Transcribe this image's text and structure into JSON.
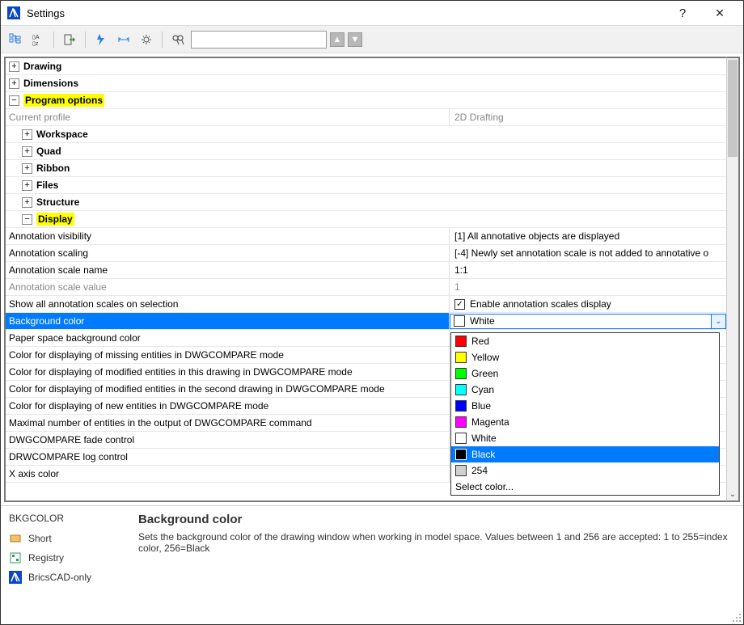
{
  "window": {
    "title": "Settings",
    "help_symbol": "?",
    "close_symbol": "✕"
  },
  "toolbar": {
    "search_placeholder": ""
  },
  "tree": {
    "top": [
      {
        "label": "Drawing",
        "expand": "+"
      },
      {
        "label": "Dimensions",
        "expand": "+"
      }
    ],
    "program_options": {
      "label": "Program options",
      "expand": "−",
      "profile_label": "Current profile",
      "profile_value": "2D Drafting",
      "children": [
        {
          "label": "Workspace",
          "expand": "+"
        },
        {
          "label": "Quad",
          "expand": "+"
        },
        {
          "label": "Ribbon",
          "expand": "+"
        },
        {
          "label": "Files",
          "expand": "+"
        },
        {
          "label": "Structure",
          "expand": "+"
        }
      ],
      "display": {
        "label": "Display",
        "expand": "−",
        "rows": [
          {
            "label": "Annotation visibility",
            "value": "[1] All annotative objects are displayed"
          },
          {
            "label": "Annotation scaling",
            "value": "[-4] Newly set annotation scale is not added to annotative o"
          },
          {
            "label": "Annotation scale name",
            "value": "1:1"
          },
          {
            "label": "Annotation scale value",
            "value": "1",
            "readonly": true
          },
          {
            "label": "Show all annotation scales on selection",
            "checkbox": true,
            "checkbox_label": "Enable annotation scales display"
          },
          {
            "label": "Background color",
            "selected": true,
            "color_value": "White",
            "color_swatch": "#ffffff"
          },
          {
            "label": "Paper space background color"
          },
          {
            "label": "Color for displaying of missing entities in DWGCOMPARE mode"
          },
          {
            "label": "Color for displaying of modified entities in this drawing in DWGCOMPARE mode"
          },
          {
            "label": "Color for displaying of modified entities in the second drawing in DWGCOMPARE mode"
          },
          {
            "label": "Color for displaying of new entities in DWGCOMPARE mode"
          },
          {
            "label": "Maximal number of entities in the output of DWGCOMPARE command"
          },
          {
            "label": "DWGCOMPARE fade control"
          },
          {
            "label": "DRWCOMPARE log control"
          },
          {
            "label": "X axis color"
          }
        ]
      }
    }
  },
  "dropdown": {
    "items": [
      {
        "label": "Red",
        "color": "#ff0000"
      },
      {
        "label": "Yellow",
        "color": "#ffff00"
      },
      {
        "label": "Green",
        "color": "#00ff00"
      },
      {
        "label": "Cyan",
        "color": "#00ffff"
      },
      {
        "label": "Blue",
        "color": "#0000ff"
      },
      {
        "label": "Magenta",
        "color": "#ff00ff"
      },
      {
        "label": "White",
        "color": "#ffffff"
      },
      {
        "label": "Black",
        "color": "#000000",
        "selected": true
      },
      {
        "label": "254",
        "color": "#d0d0d0"
      },
      {
        "label": "Select color...",
        "no_swatch": true
      }
    ]
  },
  "info": {
    "varname": "BKGCOLOR",
    "tags": [
      "Short",
      "Registry",
      "BricsCAD-only"
    ],
    "title": "Background color",
    "description": "Sets the background color of the drawing window when working in model space. Values between 1 and 256 are accepted: 1 to 255=index color, 256=Black"
  }
}
